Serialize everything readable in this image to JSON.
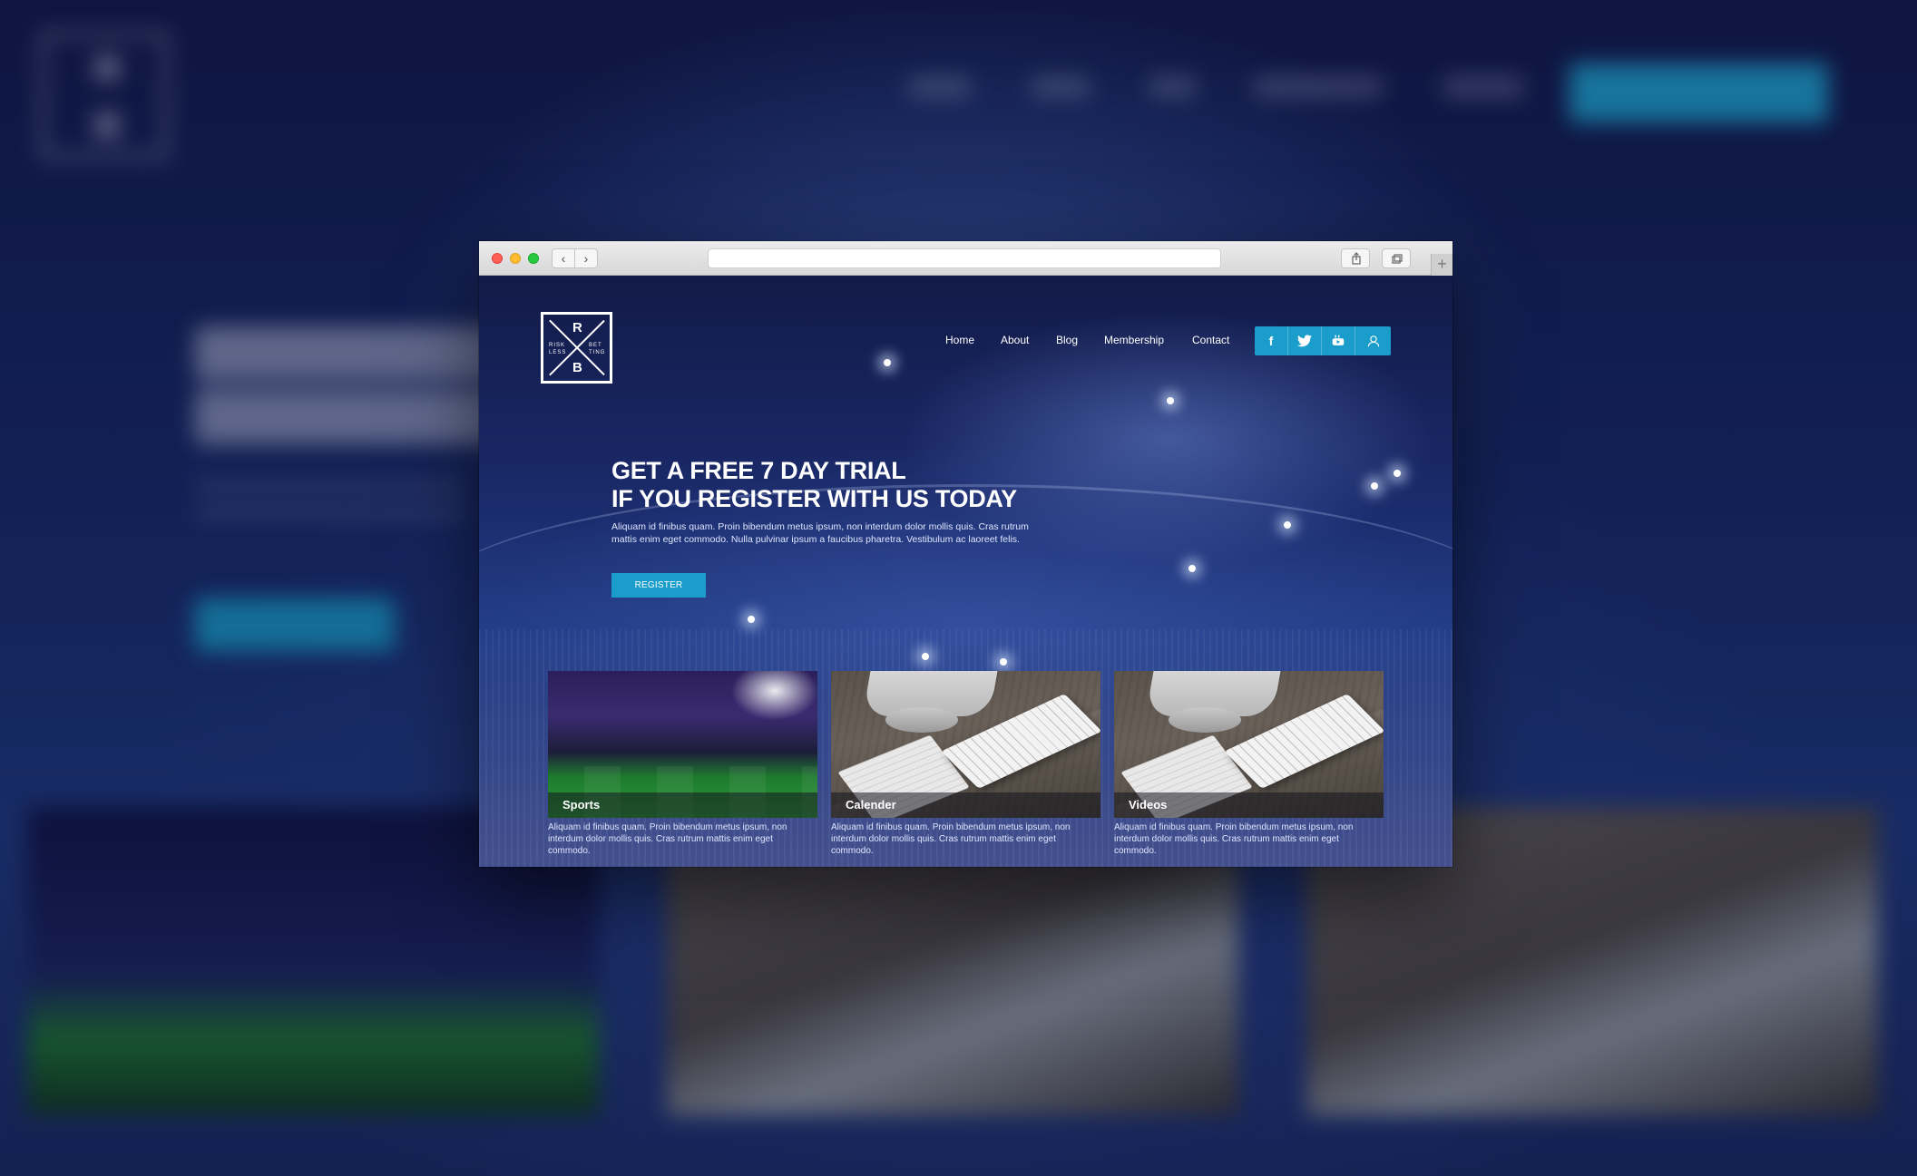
{
  "nav": {
    "items": [
      "Home",
      "About",
      "Blog",
      "Membership",
      "Contact"
    ]
  },
  "logo": {
    "top_letter": "R",
    "bottom_letter": "B",
    "left_words": "RISK\nLESS",
    "right_words": "BET\nTING"
  },
  "social": {
    "icons": [
      "facebook-icon",
      "twitter-icon",
      "youtube-icon",
      "user-icon"
    ],
    "glyphs": [
      "f",
      "🐦",
      "▶",
      "👤"
    ]
  },
  "hero": {
    "title_line1": "GET A FREE 7 DAY TRIAL",
    "title_line2": "IF YOU REGISTER WITH US TODAY",
    "text": "Aliquam id finibus quam. Proin bibendum metus ipsum, non interdum dolor mollis quis. Cras rutrum mattis enim eget commodo. Nulla pulvinar ipsum a faucibus pharetra. Vestibulum ac laoreet felis.",
    "button": "REGISTER"
  },
  "cards": [
    {
      "label": "Sports",
      "desc": "Aliquam id finibus quam. Proin bibendum metus ipsum, non interdum dolor mollis quis. Cras rutrum mattis enim eget commodo."
    },
    {
      "label": "Calender",
      "desc": "Aliquam id finibus quam. Proin bibendum metus ipsum, non interdum dolor mollis quis. Cras rutrum mattis enim eget commodo."
    },
    {
      "label": "Videos",
      "desc": "Aliquam id finibus quam. Proin bibendum metus ipsum, non interdum dolor mollis quis. Cras rutrum mattis enim eget commodo."
    }
  ],
  "browser": {
    "back_glyph": "‹",
    "forward_glyph": "›",
    "new_tab_glyph": "+"
  },
  "colors": {
    "accent": "#1b9dcb",
    "background": "#16204f"
  }
}
